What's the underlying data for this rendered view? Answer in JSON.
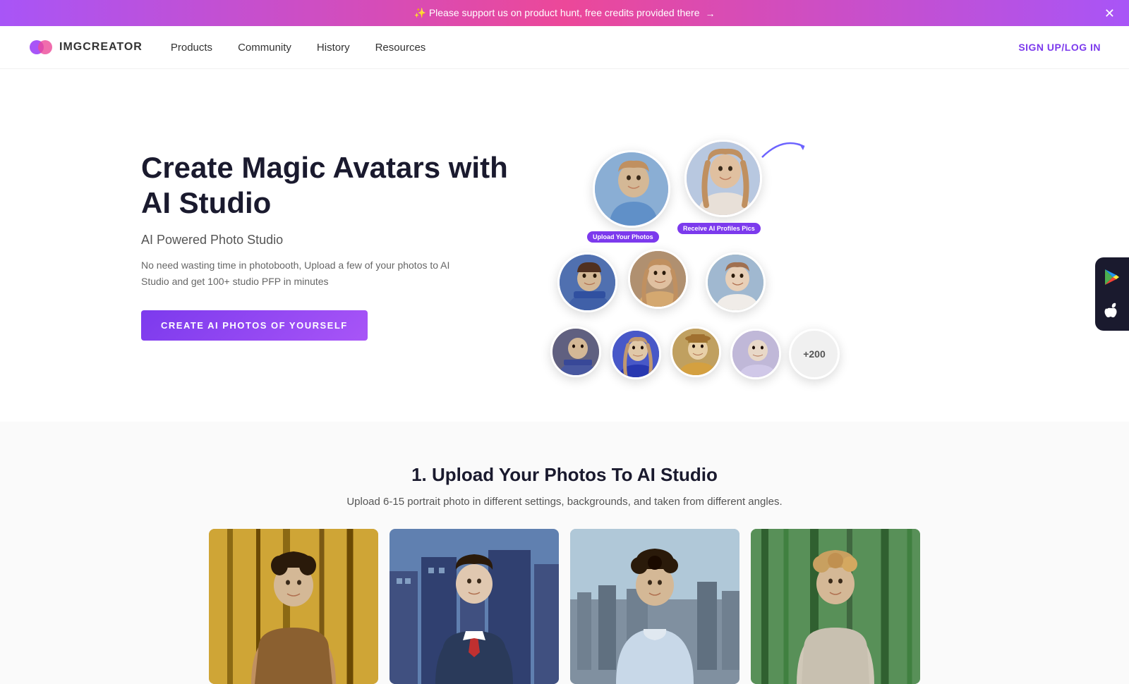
{
  "banner": {
    "text": "✨ Please support us on product hunt, free credits provided there",
    "arrow": "→",
    "close": "✕"
  },
  "navbar": {
    "logo_text": "IMGCREATOR",
    "links": [
      {
        "label": "Products",
        "id": "products"
      },
      {
        "label": "Community",
        "id": "community"
      },
      {
        "label": "History",
        "id": "history"
      },
      {
        "label": "Resources",
        "id": "resources"
      }
    ],
    "auth": "SIGN UP/LOG IN"
  },
  "hero": {
    "title": "Create Magic Avatars with AI Studio",
    "subtitle": "AI Powered Photo Studio",
    "desc": "No need wasting time in photobooth, Upload a few of your photos to AI Studio and get 100+ studio PFP in minutes",
    "cta": "CREATE AI PHOTOS OF YOURSELF",
    "upload_label": "Upload Your Photos",
    "receive_label": "Receive AI Profiles Pics",
    "plus_badge": "+200"
  },
  "section2": {
    "title": "1. Upload Your Photos To AI Studio",
    "desc": "Upload 6-15 portrait photo in different settings, backgrounds, and taken from different angles."
  },
  "app_buttons": {
    "google_play": "▶",
    "apple": ""
  }
}
